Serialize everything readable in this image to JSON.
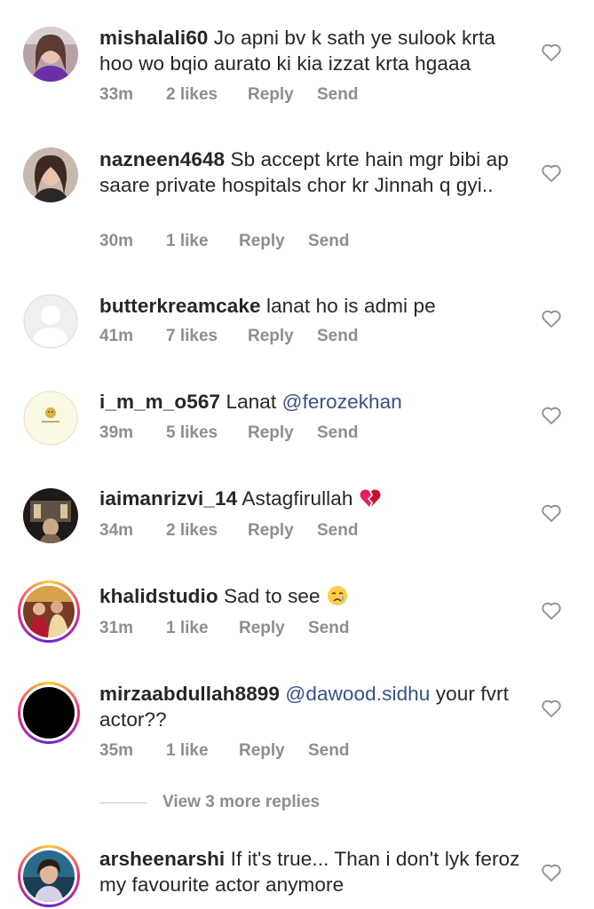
{
  "comments": [
    {
      "username": "mishalali60",
      "text": "Jo apni bv k sath ye sulook krta hoo wo bqio aurato ki kia izzat krta hgaaa",
      "time": "33m",
      "likes": "2 likes",
      "reply": "Reply",
      "send": "Send"
    },
    {
      "username": "nazneen4648",
      "text": "Sb accept krte hain mgr bibi ap saare private hospitals chor kr Jinnah q gyi..",
      "time": "30m",
      "likes": "1 like",
      "reply": "Reply",
      "send": "Send"
    },
    {
      "username": "butterkreamcake",
      "text": "lanat ho is admi pe",
      "time": "41m",
      "likes": "7 likes",
      "reply": "Reply",
      "send": "Send"
    },
    {
      "username": "i_m_m_o567",
      "text": "Lanat",
      "mention": "@ferozekhan",
      "time": "39m",
      "likes": "5 likes",
      "reply": "Reply",
      "send": "Send"
    },
    {
      "username": "iaimanrizvi_14",
      "text": "Astagfirullah",
      "emoji": "broken-heart-icon",
      "time": "34m",
      "likes": "2 likes",
      "reply": "Reply",
      "send": "Send"
    },
    {
      "username": "khalidstudio",
      "text": "Sad to see",
      "emoji": "crying-face-icon",
      "time": "31m",
      "likes": "1 like",
      "reply": "Reply",
      "send": "Send"
    },
    {
      "username": "mirzaabdullah8899",
      "mention": "@dawood.sidhu",
      "text": "your fvrt actor??",
      "time": "35m",
      "likes": "1 like",
      "reply": "Reply",
      "send": "Send"
    },
    {
      "username": "arsheenarshi",
      "text": "If it's true... Than i don't lyk feroz my favourite actor anymore"
    }
  ],
  "view_more_replies": "View 3 more replies",
  "colors": {
    "text": "#262626",
    "meta": "#8e8e8e",
    "mention": "#385185",
    "divider": "#c7c7c7"
  }
}
